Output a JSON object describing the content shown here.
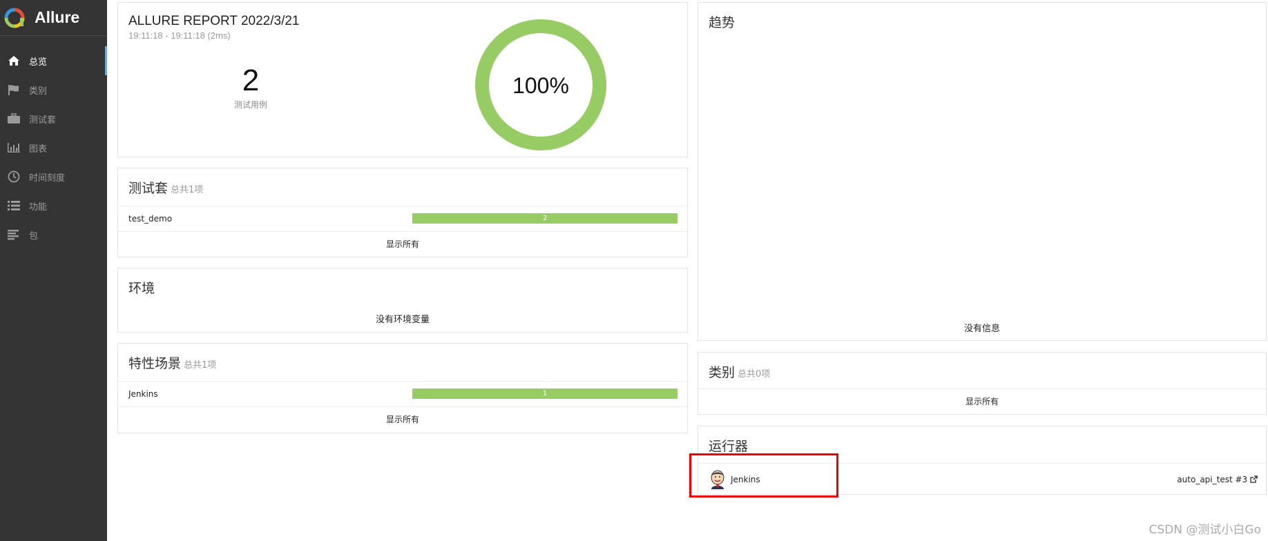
{
  "brand": {
    "name": "Allure"
  },
  "sidebar": {
    "items": [
      {
        "label": "总览"
      },
      {
        "label": "类别"
      },
      {
        "label": "测试套"
      },
      {
        "label": "图表"
      },
      {
        "label": "时间刻度"
      },
      {
        "label": "功能"
      },
      {
        "label": "包"
      }
    ]
  },
  "summary": {
    "title": "ALLURE REPORT 2022/3/21",
    "time_range": "19:11:18 - 19:11:18 (2ms)",
    "test_count": "2",
    "test_count_label": "测试用例",
    "pass_rate": "100%",
    "pass_rate_value": 1.0,
    "pass_color": "#97cc64"
  },
  "suites": {
    "title": "测试套",
    "subtitle": "总共1项",
    "rows": [
      {
        "name": "test_demo",
        "count": "2",
        "fraction": 1.0
      }
    ],
    "show_all": "显示所有"
  },
  "environment": {
    "title": "环境",
    "empty": "没有环境变量"
  },
  "features": {
    "title": "特性场景",
    "subtitle": "总共1项",
    "rows": [
      {
        "name": "Jenkins",
        "count": "1",
        "fraction": 1.0
      }
    ],
    "show_all": "显示所有"
  },
  "trend": {
    "title": "趋势",
    "empty": "没有信息"
  },
  "categories": {
    "title": "类别",
    "subtitle": "总共0项",
    "show_all": "显示所有"
  },
  "executors": {
    "title": "运行器",
    "name": "Jenkins",
    "build": "auto_api_test #3"
  },
  "watermark": "CSDN @测试小白Go",
  "highlight_color": "#ee0000"
}
